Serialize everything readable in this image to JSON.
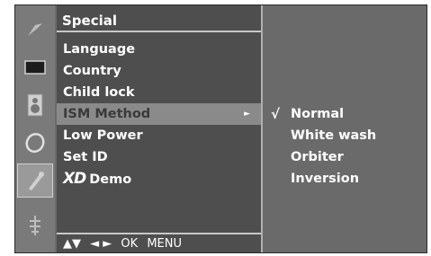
{
  "rail": {
    "items": [
      {
        "icon": "picture-icon"
      },
      {
        "icon": "screen-icon"
      },
      {
        "icon": "speaker-icon"
      },
      {
        "icon": "clock-icon"
      },
      {
        "icon": "special-icon"
      },
      {
        "icon": "input-icon"
      }
    ],
    "active_index": 4
  },
  "menu": {
    "title": "Special",
    "items": [
      {
        "label": "Language"
      },
      {
        "label": "Country"
      },
      {
        "label": "Child lock"
      },
      {
        "label": "ISM Method",
        "selected": true,
        "arrow": "►"
      },
      {
        "label": "Low Power"
      },
      {
        "label": "Set ID"
      },
      {
        "label": "Demo",
        "logo": "XD"
      }
    ],
    "footer": {
      "updown": "▲▼",
      "leftright": "◄ ►",
      "ok": "OK",
      "menu": "MENU"
    }
  },
  "submenu": {
    "items": [
      {
        "label": "Normal",
        "check": "√"
      },
      {
        "label": "White wash",
        "check": ""
      },
      {
        "label": "Orbiter",
        "check": ""
      },
      {
        "label": "Inversion",
        "check": ""
      }
    ]
  }
}
